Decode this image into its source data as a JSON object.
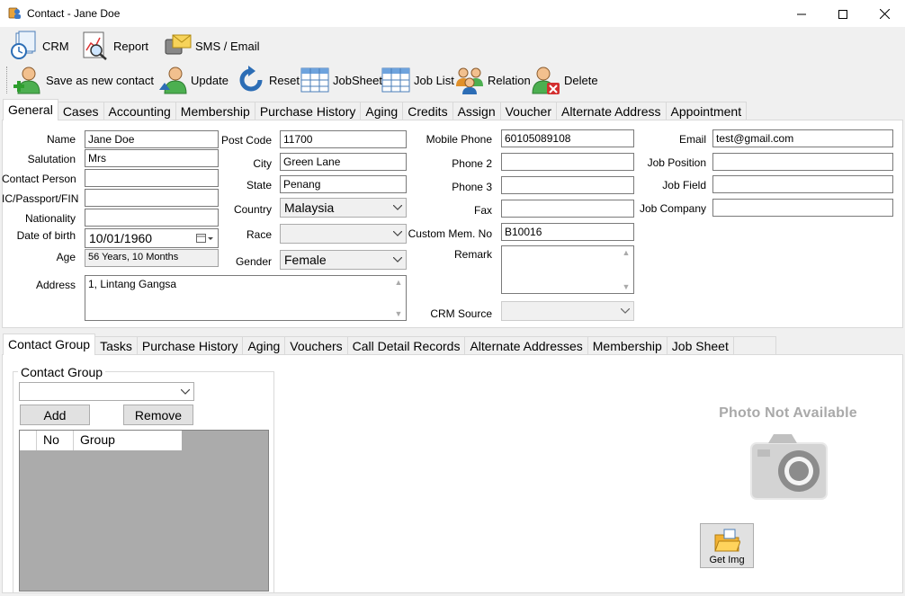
{
  "window": {
    "title": "Contact - Jane Doe"
  },
  "menu": {
    "crm": "CRM",
    "report": "Report",
    "sms_email": "SMS / Email"
  },
  "toolbar": {
    "save_new": "Save as new contact",
    "update": "Update",
    "reset": "Reset",
    "jobsheet": "JobSheet",
    "job_list": "Job List",
    "relation": "Relation",
    "delete": "Delete"
  },
  "top_tabs": [
    "General",
    "Cases",
    "Accounting",
    "Membership",
    "Purchase History",
    "Aging",
    "Credits",
    "Assign",
    "Voucher",
    "Alternate Address",
    "Appointment"
  ],
  "form": {
    "name_label": "Name",
    "name": "Jane Doe",
    "salutation_label": "Salutation",
    "salutation": "Mrs",
    "contact_person_label": "Contact Person",
    "contact_person": "",
    "ic_label": "IC/Passport/FIN",
    "ic": "",
    "nationality_label": "Nationality",
    "nationality": "",
    "dob_label": "Date of birth",
    "dob": "10/01/1960",
    "age_label": "Age",
    "age": "56 Years, 10 Months",
    "address_label": "Address",
    "address": "1, Lintang Gangsa",
    "postcode_label": "Post Code",
    "postcode": "11700",
    "city_label": "City",
    "city": "Green Lane",
    "state_label": "State",
    "state": "Penang",
    "country_label": "Country",
    "country": "Malaysia",
    "race_label": "Race",
    "race": "",
    "gender_label": "Gender",
    "gender": "Female",
    "mobile_label": "Mobile Phone",
    "mobile": "60105089108",
    "phone2_label": "Phone 2",
    "phone2": "",
    "phone3_label": "Phone 3",
    "phone3": "",
    "fax_label": "Fax",
    "fax": "",
    "custom_mem_label": "Custom Mem. No",
    "custom_mem": "B10016",
    "remark_label": "Remark",
    "remark": "",
    "crm_source_label": "CRM Source",
    "crm_source": "",
    "email_label": "Email",
    "email": "test@gmail.com",
    "job_position_label": "Job Position",
    "job_position": "",
    "job_field_label": "Job Field",
    "job_field": "",
    "job_company_label": "Job Company",
    "job_company": ""
  },
  "bottom_tabs": [
    "Contact Group",
    "Tasks",
    "Purchase History",
    "Aging",
    "Vouchers",
    "Call Detail Records",
    "Alternate Addresses",
    "Membership",
    "Job Sheet"
  ],
  "contact_group": {
    "legend": "Contact Group",
    "selected": "",
    "add": "Add",
    "remove": "Remove",
    "col_no": "No",
    "col_group": "Group"
  },
  "photo": {
    "placeholder": "Photo Not Available",
    "get_img": "Get Img"
  }
}
